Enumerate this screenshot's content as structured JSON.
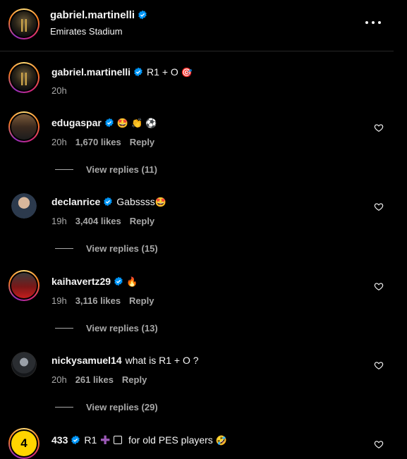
{
  "header": {
    "username": "gabriel.martinelli",
    "location": "Emirates Stadium"
  },
  "caption": {
    "username": "gabriel.martinelli",
    "text": "R1 + O",
    "emoji": "🎯",
    "time": "20h"
  },
  "comments": [
    {
      "username": "edugaspar",
      "text": "",
      "emoji": "🤩 👏 ⚽",
      "time": "20h",
      "likes": "1,670 likes",
      "reply": "Reply",
      "view_replies": "View replies (11)"
    },
    {
      "username": "declanrice",
      "text": "Gabssss",
      "emoji": "🤩",
      "time": "19h",
      "likes": "3,404 likes",
      "reply": "Reply",
      "view_replies": "View replies (15)"
    },
    {
      "username": "kaihavertz29",
      "text": "",
      "emoji": "🔥",
      "time": "19h",
      "likes": "3,116 likes",
      "reply": "Reply",
      "view_replies": "View replies (13)"
    },
    {
      "username": "nickysamuel14",
      "text": "what is R1 + O ?",
      "emoji": "",
      "time": "20h",
      "likes": "261 likes",
      "reply": "Reply",
      "view_replies": "View replies (29)"
    },
    {
      "username": "433",
      "text_a": "R1",
      "text_b": "for old PES players",
      "emoji": "🤣"
    }
  ],
  "avatar_433_label": "4",
  "colors": {
    "background": "#000000",
    "verified": "#0095f6",
    "secondary_text": "#a8a8a8"
  },
  "icons": [
    "verified-badge-icon",
    "more-options-icon",
    "heart-icon",
    "plus-icon",
    "square-icon"
  ]
}
